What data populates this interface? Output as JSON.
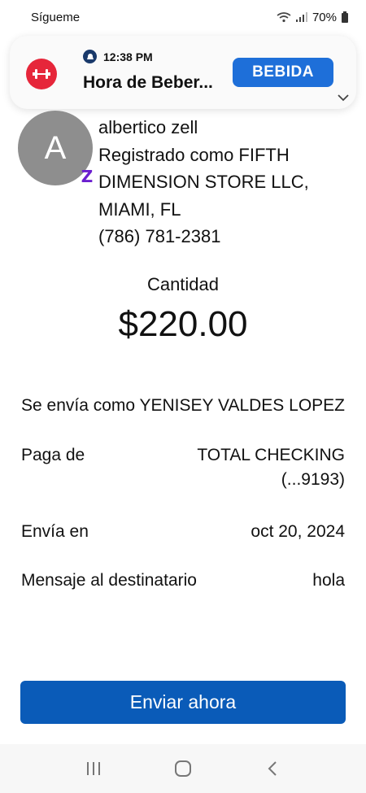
{
  "status_bar": {
    "left_label": "Sígueme",
    "battery": "70%"
  },
  "notification": {
    "time": "12:38 PM",
    "title": "Hora de Beber...",
    "action_label": "BEBIDA"
  },
  "recipient": {
    "avatar_initial": "A",
    "name": "albertico zell",
    "registration": "Registrado como FIFTH DIMENSION STORE LLC, MIAMI, FL",
    "phone": "(786) 781-2381"
  },
  "amount": {
    "label": "Cantidad",
    "value": "$220.00"
  },
  "details": [
    {
      "label": "Se envía como",
      "value": "YENISEY VALDES LOPEZ"
    },
    {
      "label": "Paga de",
      "value": "TOTAL CHECKING (...9193)"
    },
    {
      "label": "Envía en",
      "value": "oct 20, 2024"
    },
    {
      "label": "Mensaje al destinatario",
      "value": "hola"
    }
  ],
  "send_button_label": "Enviar ahora",
  "colors": {
    "primary": "#0a5bb8",
    "notification_button": "#1e6fd9",
    "app_icon": "#e6263a",
    "zelle": "#6b1fcf"
  }
}
